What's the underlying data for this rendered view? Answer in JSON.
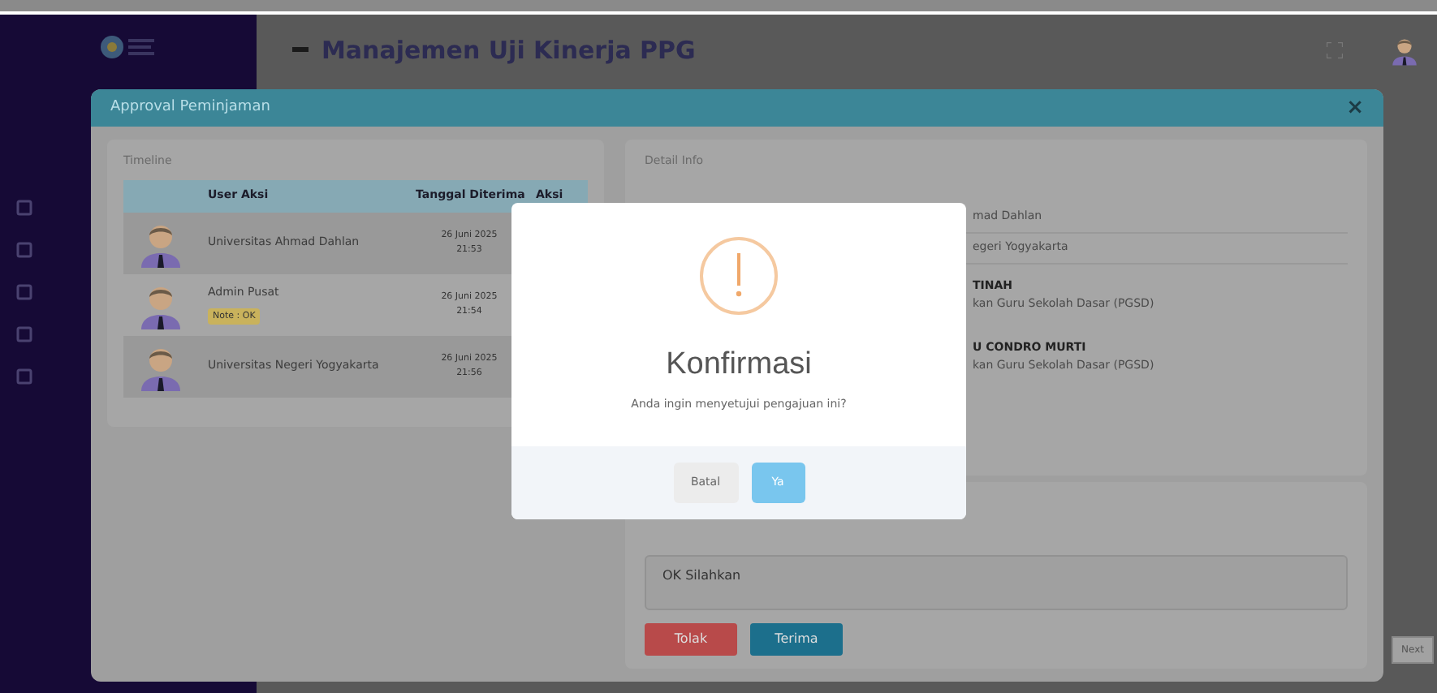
{
  "header": {
    "title": "Manajemen Uji Kinerja PPG"
  },
  "sidebar": {
    "items": [
      {
        "kind": "icon"
      },
      {
        "kind": "icon"
      },
      {
        "kind": "icon"
      },
      {
        "kind": "icon"
      },
      {
        "kind": "icon"
      }
    ]
  },
  "modal": {
    "title": "Approval Peminjaman",
    "close": "×",
    "timeline": {
      "title": "Timeline",
      "columns": [
        "User Aksi",
        "Tanggal Diterima",
        "Aksi"
      ],
      "rows": [
        {
          "user": "Universitas Ahmad Dahlan",
          "date": "26 Juni 2025",
          "time": "21:53"
        },
        {
          "user": "Admin Pusat",
          "note": "Note : OK",
          "date": "26 Juni 2025",
          "time": "21:54"
        },
        {
          "user": "Universitas Negeri Yogyakarta",
          "date": "26 Juni 2025",
          "time": "21:56"
        }
      ]
    },
    "detail": {
      "title": "Detail Info",
      "rows": [
        {
          "lines": [
            "mad Dahlan"
          ]
        },
        {
          "lines": [
            "egeri Yogyakarta"
          ]
        },
        {
          "name": "TINAH",
          "lines": [
            "kan Guru Sekolah Dasar (PGSD)"
          ]
        },
        {
          "name": "U CONDRO MURTI",
          "lines": [
            "kan Guru Sekolah Dasar (PGSD)"
          ]
        }
      ]
    },
    "remarks": {
      "value": "OK Silahkan"
    },
    "buttons": [
      {
        "label": "Tolak",
        "kind": "danger"
      },
      {
        "label": "Terima",
        "kind": "primary"
      }
    ]
  },
  "confirm": {
    "title": "Konfirmasi",
    "text": "Anda ingin menyetujui pengajuan ini?",
    "buttons": [
      {
        "label": "Batal",
        "kind": "cancel"
      },
      {
        "label": "Ya",
        "kind": "confirm"
      }
    ]
  },
  "pager": {
    "next": "Next"
  }
}
